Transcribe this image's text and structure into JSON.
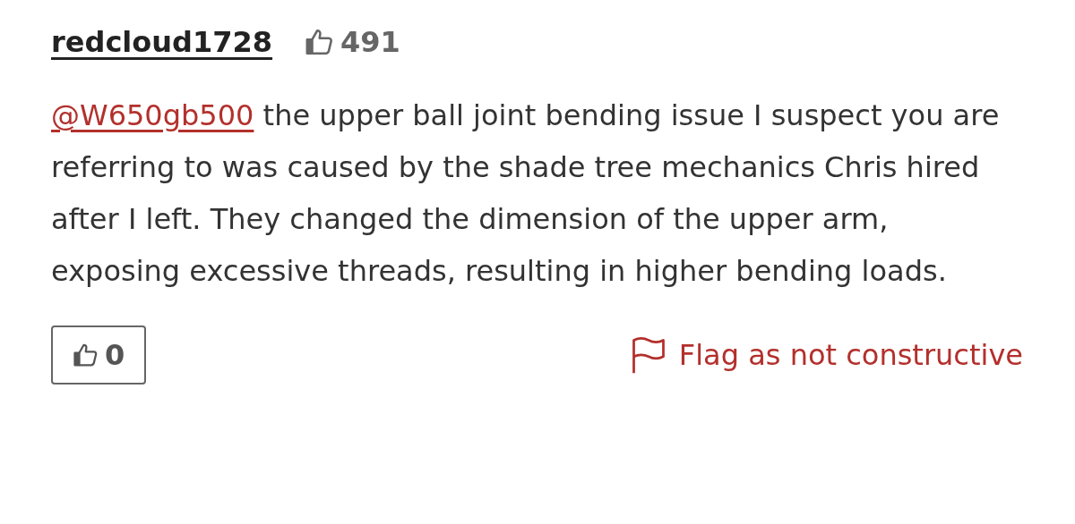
{
  "comment": {
    "author": "redcloud1728",
    "author_likes": "491",
    "mention": "@W650gb500",
    "text": " the upper ball joint bending issue I suspect you are referring to was caused by the shade tree mechanics Chris hired after I left. They changed the dimension of the upper arm, exposing excessive threads, resulting in higher bending loads.",
    "like_count": "0",
    "flag_label": "Flag as not constructive"
  }
}
